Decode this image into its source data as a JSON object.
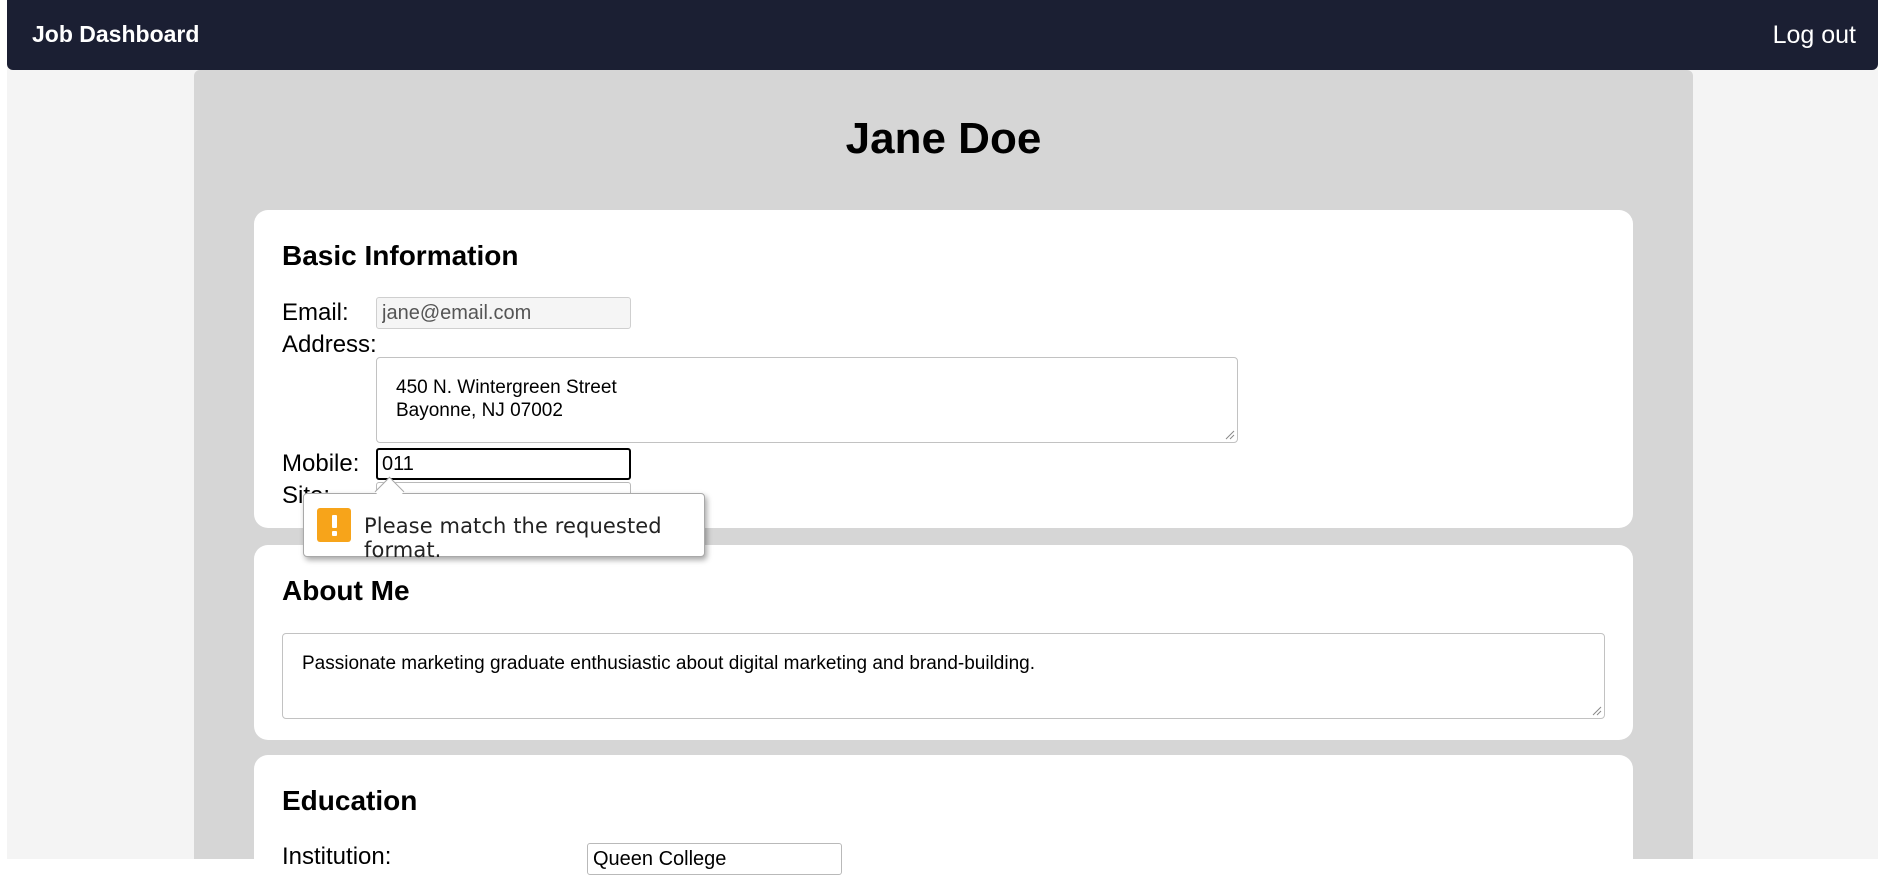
{
  "header": {
    "brand": "Job Dashboard",
    "logout_label": "Log out"
  },
  "profile": {
    "name": "Jane Doe"
  },
  "basic_info": {
    "title": "Basic Information",
    "email_label": "Email:",
    "email_value": "jane@email.com",
    "address_label": "Address:",
    "address_line1": "450 N. Wintergreen Street",
    "address_line2": "Bayonne, NJ 07002",
    "mobile_label": "Mobile:",
    "mobile_value": "011",
    "site_label": "Site:"
  },
  "validation": {
    "message": "Please match the requested format.",
    "icon": "warning-icon",
    "icon_color": "#f7a41a"
  },
  "about": {
    "title": "About Me",
    "text": "Passionate marketing graduate enthusiastic about digital marketing and brand-building."
  },
  "education": {
    "title": "Education",
    "institution_label": "Institution:",
    "institution_value": "Queen College"
  },
  "colors": {
    "navbar": "#1b1f33",
    "main_panel": "#d6d6d6",
    "card": "#ffffff"
  }
}
